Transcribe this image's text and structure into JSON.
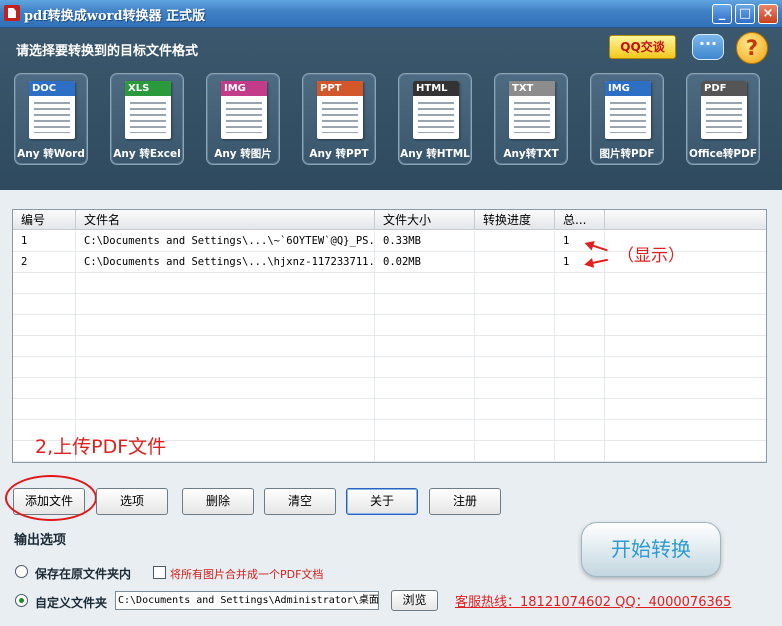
{
  "window": {
    "title": "pdf转换成word转换器  正式版",
    "min": "_",
    "max": "□",
    "close": "×"
  },
  "header": {
    "heading": "请选择要转换到的目标文件格式",
    "qq": "QQ交谈",
    "chat": "···",
    "help": "?"
  },
  "tiles": [
    {
      "tag": "DOC",
      "label": "Any 转Word",
      "color": "#2d6fc4"
    },
    {
      "tag": "XLS",
      "label": "Any 转Excel",
      "color": "#2a9a3a"
    },
    {
      "tag": "IMG",
      "label": "Any 转图片",
      "color": "#c23c8a"
    },
    {
      "tag": "PPT",
      "label": "Any 转PPT",
      "color": "#d2572a"
    },
    {
      "tag": "HTML",
      "label": "Any 转HTML",
      "color": "#333333"
    },
    {
      "tag": "TXT",
      "label": "Any转TXT",
      "color": "#8c8c8c"
    },
    {
      "tag": "IMG",
      "label": "图片转PDF",
      "color": "#2d6fc4"
    },
    {
      "tag": "PDF",
      "label": "Office转PDF",
      "color": "#555555"
    }
  ],
  "table": {
    "columns": [
      "编号",
      "文件名",
      "文件大小",
      "转换进度",
      "总..."
    ],
    "rows": [
      {
        "no": "1",
        "name": "C:\\Documents and Settings\\...\\~`6OYTEW`@Q}_PS...",
        "size": "0.33MB",
        "progress": "",
        "total": "1"
      },
      {
        "no": "2",
        "name": "C:\\Documents and Settings\\...\\hjxnz-117233711...",
        "size": "0.02MB",
        "progress": "",
        "total": "1"
      }
    ]
  },
  "annotations": {
    "show": "（显示）",
    "step": "2,上传PDF文件"
  },
  "buttons": {
    "add": "添加文件",
    "options": "选项",
    "delete": "删除",
    "clear": "清空",
    "about": "关于",
    "register": "注册"
  },
  "output": {
    "heading": "输出选项",
    "keep_original": "保存在原文件夹内",
    "merge_images": "将所有图片合并成一个PDF文档",
    "custom_folder": "自定义文件夹",
    "path": "C:\\Documents and Settings\\Administrator\\桌面",
    "browse": "浏览",
    "keep_original_selected": false,
    "custom_folder_selected": true,
    "merge_checked": false
  },
  "start": "开始转换",
  "hotline": "客服热线：18121074602 QQ：4000076365"
}
